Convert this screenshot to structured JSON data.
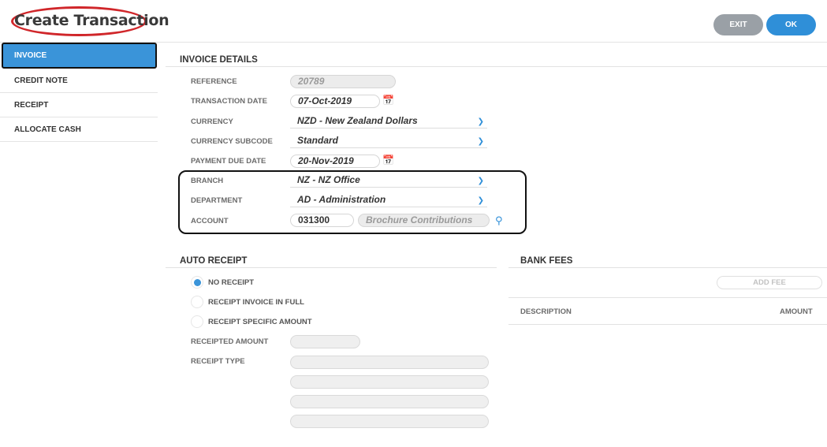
{
  "header": {
    "title": "Create Transaction",
    "exit_label": "EXIT",
    "ok_label": "OK"
  },
  "sidebar": {
    "items": [
      {
        "label": "INVOICE",
        "active": true
      },
      {
        "label": "CREDIT NOTE",
        "active": false
      },
      {
        "label": "RECEIPT",
        "active": false
      },
      {
        "label": "ALLOCATE CASH",
        "active": false
      }
    ]
  },
  "invoice": {
    "section_title": "INVOICE DETAILS",
    "reference_label": "REFERENCE",
    "reference_value": "20789",
    "transaction_date_label": "TRANSACTION DATE",
    "transaction_date_value": "07-Oct-2019",
    "currency_label": "CURRENCY",
    "currency_value": "NZD - New Zealand Dollars",
    "currency_subcode_label": "CURRENCY SUBCODE",
    "currency_subcode_value": "Standard",
    "payment_due_label": "PAYMENT DUE DATE",
    "payment_due_value": "20-Nov-2019",
    "branch_label": "BRANCH",
    "branch_value": "NZ - NZ Office",
    "department_label": "DEPARTMENT",
    "department_value": "AD - Administration",
    "account_label": "ACCOUNT",
    "account_code": "031300",
    "account_name": "Brochure Contributions"
  },
  "auto_receipt": {
    "section_title": "AUTO RECEIPT",
    "options": [
      {
        "label": "NO RECEIPT",
        "checked": true
      },
      {
        "label": "RECEIPT INVOICE IN FULL",
        "checked": false
      },
      {
        "label": "RECEIPT SPECIFIC AMOUNT",
        "checked": false
      }
    ],
    "receipted_amount_label": "RECEIPTED AMOUNT",
    "receipt_type_label": "RECEIPT TYPE"
  },
  "bank_fees": {
    "section_title": "BANK FEES",
    "add_fee_label": "ADD FEE",
    "description_header": "DESCRIPTION",
    "amount_header": "AMOUNT"
  },
  "colors": {
    "accent": "#3a94d9",
    "highlight_oval": "#d0262a",
    "exit_button": "#9aa0a6"
  },
  "icons": {
    "calendar": "calendar-icon",
    "dropdown": "chevron-down-icon",
    "search": "search-icon"
  }
}
